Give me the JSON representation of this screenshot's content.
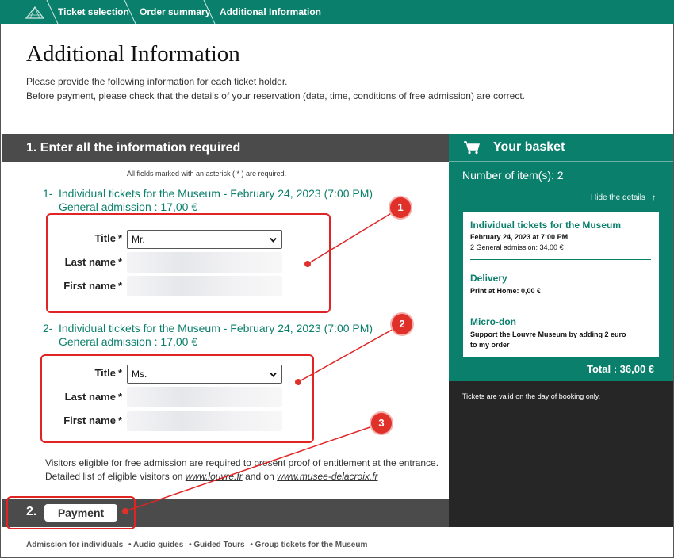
{
  "nav": {
    "breadcrumbs": [
      "Ticket selection",
      "Order summary",
      "Additional Information"
    ]
  },
  "page": {
    "title": "Additional Information",
    "intro_line1": "Please provide the following information for each ticket holder.",
    "intro_line2": "Before payment, please check that the details of your reservation (date, time, conditions of free admission) are correct."
  },
  "section1": {
    "heading": "1. Enter all the information required",
    "required_note": "All fields marked with an asterisk ( * ) are required."
  },
  "tickets": [
    {
      "number": "1-",
      "title": "Individual tickets for the Museum - February 24, 2023 (7:00 PM)",
      "admission": "General admission :  17,00 €",
      "title_label": "Title",
      "title_value": "Mr.",
      "last_name_label": "Last name",
      "first_name_label": "First name",
      "asterisk": "*"
    },
    {
      "number": "2-",
      "title": "Individual tickets for the Museum - February 24, 2023 (7:00 PM)",
      "admission": "General admission :  17,00 €",
      "title_label": "Title",
      "title_value": "Ms.",
      "last_name_label": "Last name",
      "first_name_label": "First name",
      "asterisk": "*"
    }
  ],
  "visitors": {
    "line1": "Visitors eligible for free admission are required to present proof of entitlement at the entrance.",
    "line2_prefix": "Detailed list of eligible visitors on ",
    "link1": "www.louvre.fr",
    "line2_mid": " and on ",
    "link2": "www.musee-delacroix.fr"
  },
  "section2": {
    "number": "2.",
    "button_label": "Payment"
  },
  "basket": {
    "title": "Your basket",
    "items_count": "Number of item(s): 2",
    "hide_details": "Hide the details",
    "hide_arrow": "↑",
    "card": {
      "item_title": "Individual tickets for the Museum",
      "item_date": "February 24, 2023 at 7:00 PM",
      "item_detail": "2 General admission: 34,00 €",
      "delivery_title": "Delivery",
      "delivery_detail": "Print at Home: 0,00 €",
      "microdon_title": "Micro-don",
      "microdon_detail_1": "Support the Louvre Museum by adding 2 euro",
      "microdon_detail_2": "to my order"
    },
    "total": "Total : 36,00 €",
    "validity_note": "Tickets are valid on the day of booking only."
  },
  "footer": {
    "links": [
      "Admission for individuals",
      "• Audio guides",
      "• Guided Tours",
      "• Group tickets for the Museum"
    ]
  },
  "annotations": {
    "badge1": "1",
    "badge2": "2",
    "badge3": "3"
  },
  "colors": {
    "brand_green": "#0a7f6b",
    "section_bar": "#4b4b4b",
    "annotation_red": "#e02424"
  }
}
